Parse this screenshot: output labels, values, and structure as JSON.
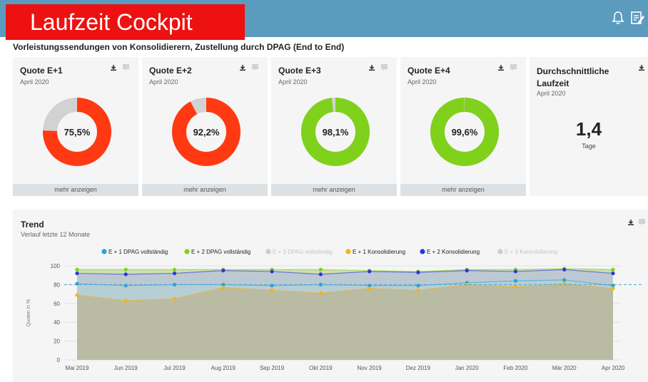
{
  "header": {
    "app_title": "Laufzeit Cockpit",
    "icons": [
      "bell-icon",
      "edit-note-icon"
    ],
    "colors": {
      "topbar": "#5b9bbd",
      "title_bg": "#ee1111"
    }
  },
  "page_subtitle": "Vorleistungssendungen von Konsolidierern, Zustellung durch DPAG (End to End)",
  "cards": [
    {
      "title": "Quote E+1",
      "period": "April 2020",
      "value": 75.5,
      "value_label": "75,5%",
      "color": "#ff3a12",
      "more_label": "mehr anzeigen"
    },
    {
      "title": "Quote E+2",
      "period": "April 2020",
      "value": 92.2,
      "value_label": "92,2%",
      "color": "#ff3a12",
      "more_label": "mehr anzeigen"
    },
    {
      "title": "Quote E+3",
      "period": "April 2020",
      "value": 98.1,
      "value_label": "98,1%",
      "color": "#7fd11b",
      "more_label": "mehr anzeigen"
    },
    {
      "title": "Quote E+4",
      "period": "April 2020",
      "value": 99.6,
      "value_label": "99,6%",
      "color": "#7fd11b",
      "more_label": "mehr anzeigen"
    }
  ],
  "average": {
    "title": "Durchschnittliche Laufzeit",
    "period": "April 2020",
    "value": "1,4",
    "unit": "Tage"
  },
  "trend": {
    "title": "Trend",
    "subtitle": "Verlauf letzte 12 Monate"
  },
  "chart_data": {
    "type": "area",
    "categories": [
      "Mai 2019",
      "Jun 2019",
      "Jul 2019",
      "Aug 2019",
      "Sep 2019",
      "Okt 2019",
      "Nov 2019",
      "Dez 2019",
      "Jan 2020",
      "Feb 2020",
      "Mär 2020",
      "Apr 2020"
    ],
    "ylabel": "Quoten in %",
    "ylim": [
      0,
      100
    ],
    "yticks": [
      "0",
      "20",
      "40",
      "60",
      "80",
      "100"
    ],
    "target_line": 80,
    "legend_position": "top",
    "series": [
      {
        "name": "E + 1 DPAG vollständig",
        "color": "#2aa3d6",
        "visible": true,
        "values": [
          81,
          79,
          80,
          80,
          79,
          80,
          79,
          79,
          82,
          84,
          85,
          79
        ]
      },
      {
        "name": "E + 2 DPAG vollständig",
        "color": "#7fd11b",
        "visible": true,
        "values": [
          96,
          96,
          96,
          96,
          96,
          96,
          95,
          94,
          96,
          96,
          97,
          96
        ]
      },
      {
        "name": "E + 3 DPAG vollständig",
        "color": "#cccccc",
        "visible": false,
        "values": []
      },
      {
        "name": "E + 1 Konsolidierung",
        "color": "#f5b21b",
        "visible": true,
        "values": [
          69,
          63,
          65,
          77,
          74,
          71,
          76,
          74,
          80,
          78,
          81,
          76
        ]
      },
      {
        "name": "E + 2 Konsolidierung",
        "color": "#2d37d8",
        "visible": true,
        "values": [
          92,
          91,
          92,
          95,
          94,
          91,
          94,
          93,
          95,
          94,
          96,
          92
        ]
      },
      {
        "name": "E + 3 Konsolidierung",
        "color": "#cccccc",
        "visible": false,
        "values": []
      }
    ]
  }
}
